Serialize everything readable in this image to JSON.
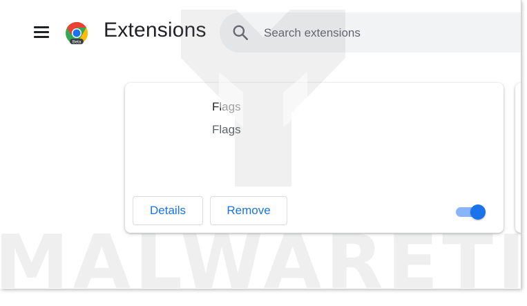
{
  "header": {
    "menu_icon": "hamburger-menu-icon",
    "logo_icon": "chrome-beta-logo-icon",
    "logo_badge": "Beta",
    "title": "Extensions"
  },
  "search": {
    "icon": "search-icon",
    "placeholder": "Search extensions",
    "value": ""
  },
  "extensions": [
    {
      "name": "Flags",
      "description": "Flags",
      "details_label": "Details",
      "remove_label": "Remove",
      "enabled": true
    }
  ],
  "colors": {
    "accent": "#1a73e8",
    "toggle_track": "#8ab4f8",
    "search_bg": "#f1f3f4",
    "text_primary": "#202124",
    "text_secondary": "#5f6368"
  },
  "watermark": {
    "text": "MALWARETIPS",
    "icon": "malwaretips-shield-logo"
  }
}
